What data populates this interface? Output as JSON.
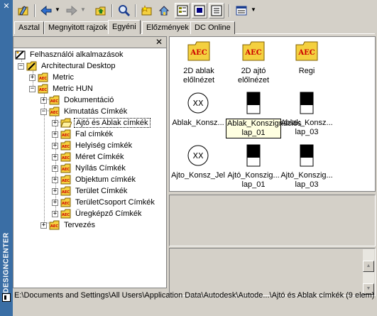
{
  "window": {
    "vertical_title": "DESIGNCENTER"
  },
  "toolbar": {
    "buttons": [
      "load-icon",
      "back-icon",
      "forward-icon",
      "up-icon",
      "search-icon",
      "favorites-icon",
      "home-icon",
      "tree-toggle-icon",
      "preview-icon",
      "description-icon",
      "views-icon"
    ]
  },
  "tabs": [
    {
      "label": "Asztal"
    },
    {
      "label": "Megnyitott rajzok"
    },
    {
      "label": "Egyéni",
      "active": true
    },
    {
      "label": "Előzmények"
    },
    {
      "label": "DC Online"
    }
  ],
  "tree": {
    "nodes": [
      {
        "label": "Felhasználói alkalmazások"
      },
      {
        "label": "Architectural Desktop"
      },
      {
        "label": "Metric"
      },
      {
        "label": "Metric HUN"
      },
      {
        "label": "Dokumentáció"
      },
      {
        "label": "Kimutatás Címkék"
      },
      {
        "label": "Ajtó és Ablak címkék",
        "selected": true
      },
      {
        "label": "Fal címkék"
      },
      {
        "label": "Helyiség címkék"
      },
      {
        "label": "Méret Címkék"
      },
      {
        "label": "Nyílás Címkék"
      },
      {
        "label": "Objektum címkék"
      },
      {
        "label": "Terület Címkék"
      },
      {
        "label": "TerületCsoport Címkék"
      },
      {
        "label": "Üregképző Címkék"
      },
      {
        "label": "Tervezés"
      }
    ]
  },
  "items": [
    {
      "caption": "2D ablak előlnézet",
      "icon": "aec-folder-icon"
    },
    {
      "caption": "2D ajtó előlnézet",
      "icon": "aec-folder-icon"
    },
    {
      "caption": "Regi",
      "icon": "aec-folder-icon"
    },
    {
      "caption": "Ablak_Konsz...",
      "icon": "tag-circle-icon"
    },
    {
      "caption": "Ablak_Konszignációs lap_01",
      "icon": "schedule-block-icon",
      "hovered": true
    },
    {
      "caption": "Ablak_Konsz... lap_03",
      "icon": "schedule-block-icon"
    },
    {
      "caption": "Ajto_Konsz_Jel",
      "icon": "tag-circle-icon"
    },
    {
      "caption": "Ajtó_Konszig... lap_01",
      "icon": "schedule-block-icon"
    },
    {
      "caption": "Ajtó_Konszig... lap_03",
      "icon": "schedule-block-icon"
    }
  ],
  "aec_label": "AEC",
  "xx_label": "XX",
  "status": {
    "path": "E:\\Documents and Settings\\All Users\\Application Data\\Autodesk\\Autode...\\Ajtó és Ablak címkék (9 elem)"
  },
  "colors": {
    "title_strip": "#3a6ea5",
    "folder_yellow": "#f4d03f",
    "aec_red": "#cc0000",
    "window_bg": "#d4d0c8"
  }
}
